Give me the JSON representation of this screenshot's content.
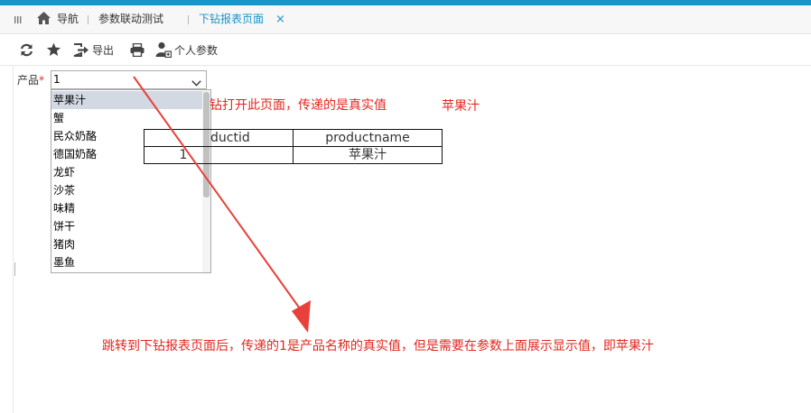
{
  "nav": {
    "menu_icon": "menu-lines-icon",
    "home_icon": "home-icon",
    "home_label": "导航",
    "tab_param": "参数联动测试",
    "tab_active": "下钻报表页面",
    "tab_close": "×"
  },
  "toolbar": {
    "refresh_icon": "refresh-icon",
    "favorite_icon": "star-icon",
    "export_icon": "export-icon",
    "export_label": "导出",
    "print_icon": "printer-icon",
    "personal_icon": "user-settings-icon",
    "personal_label": "个人参数"
  },
  "param": {
    "label": "产品",
    "required_mark": "*",
    "value": "1"
  },
  "dropdown": {
    "options": [
      "苹果汁",
      "蟹",
      "民众奶酪",
      "德国奶酪",
      "龙虾",
      "沙茶",
      "味精",
      "饼干",
      "猪肉",
      "墨鱼"
    ],
    "selected_index": 0
  },
  "report": {
    "header_note": "钻打开此页面，传递的是真实值",
    "header_value": "苹果汁",
    "table": {
      "columns": [
        "ductid",
        "productname"
      ],
      "rows": [
        [
          "1",
          "苹果汁"
        ]
      ]
    }
  },
  "annotation": {
    "text": "跳转到下钻报表页面后，传递的1是产品名称的真实值，但是需要在参数上面展示显示值，即苹果汁"
  },
  "colors": {
    "accent": "#1a93c8",
    "annotation_red": "#e3261f",
    "selected_option_bg": "#d3d9e3"
  }
}
